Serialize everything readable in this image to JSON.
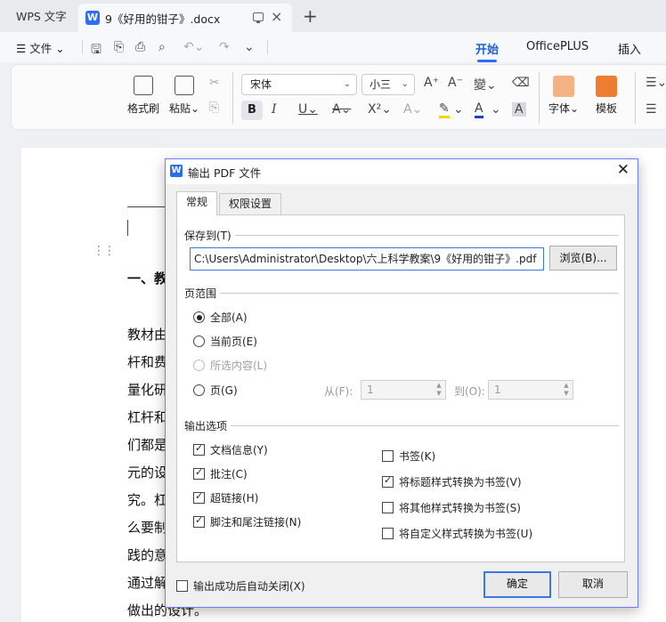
{
  "app_tab": "WPS 文字",
  "doc_tab": "9《好用的钳子》.docx",
  "menu": {
    "file": "文件"
  },
  "ribbon_tabs": [
    "开始",
    "OfficePLUS",
    "插入"
  ],
  "ribbon": {
    "format_painter": "格式刷",
    "paste": "粘贴",
    "font": "宋体",
    "size": "小三",
    "style": "字体",
    "template": "模板"
  },
  "document": {
    "heading": "一、教",
    "lines": [
      "教材由",
      "杆和费",
      "量化研",
      "杠杆和",
      "们都是",
      "元的设",
      "究。杠",
      "么要制",
      "践的意",
      "通过解",
      "做出的设计。"
    ]
  },
  "dialog": {
    "title": "输出 PDF 文件",
    "tabs": [
      "常规",
      "权限设置"
    ],
    "save_to_label": "保存到(T)",
    "path": "C:\\Users\\Administrator\\Desktop\\六上科学教案\\9《好用的钳子》.pdf",
    "browse": "浏览(B)...",
    "range_label": "页范围",
    "range_options": [
      "全部(A)",
      "当前页(E)",
      "所选内容(L)",
      "页(G)"
    ],
    "from_label": "从(F):",
    "from_value": "1",
    "to_label": "到(O):",
    "to_value": "1",
    "output_label": "输出选项",
    "left_options": [
      "文档信息(Y)",
      "批注(C)",
      "超链接(H)",
      "脚注和尾注链接(N)"
    ],
    "right_options": [
      "书签(K)",
      "将标题样式转换为书签(V)",
      "将其他样式转换为书签(S)",
      "将自定义样式转换为书签(U)"
    ],
    "auto_close": "输出成功后自动关闭(X)",
    "ok": "确定",
    "cancel": "取消"
  }
}
